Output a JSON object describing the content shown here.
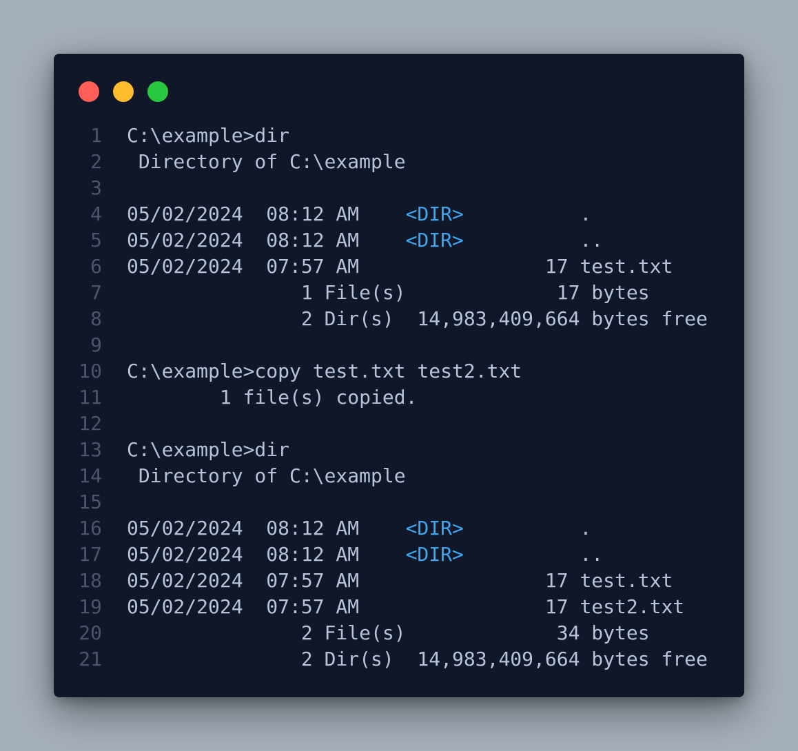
{
  "window": {
    "controls": [
      "close",
      "minimize",
      "maximize"
    ],
    "colors": {
      "background": "#0f1729",
      "text": "#b7c3d8",
      "line_number": "#4a556b",
      "dir_tag": "#3fa7f0",
      "close": "#ff5f57",
      "minimize": "#febc2e",
      "maximize": "#28c840"
    }
  },
  "lines": [
    {
      "n": "1",
      "pre": "C:\\example>dir",
      "tag": "",
      "post": ""
    },
    {
      "n": "2",
      "pre": " Directory of C:\\example",
      "tag": "",
      "post": ""
    },
    {
      "n": "3",
      "pre": "",
      "tag": "",
      "post": ""
    },
    {
      "n": "4",
      "pre": "05/02/2024  08:12 AM    ",
      "tag": "<DIR>",
      "post": "          ."
    },
    {
      "n": "5",
      "pre": "05/02/2024  08:12 AM    ",
      "tag": "<DIR>",
      "post": "          .."
    },
    {
      "n": "6",
      "pre": "05/02/2024  07:57 AM                17 test.txt",
      "tag": "",
      "post": ""
    },
    {
      "n": "7",
      "pre": "               1 File(s)             17 bytes",
      "tag": "",
      "post": ""
    },
    {
      "n": "8",
      "pre": "               2 Dir(s)  14,983,409,664 bytes free",
      "tag": "",
      "post": ""
    },
    {
      "n": "9",
      "pre": "",
      "tag": "",
      "post": ""
    },
    {
      "n": "10",
      "pre": "C:\\example>copy test.txt test2.txt",
      "tag": "",
      "post": ""
    },
    {
      "n": "11",
      "pre": "        1 file(s) copied.",
      "tag": "",
      "post": ""
    },
    {
      "n": "12",
      "pre": "",
      "tag": "",
      "post": ""
    },
    {
      "n": "13",
      "pre": "C:\\example>dir",
      "tag": "",
      "post": ""
    },
    {
      "n": "14",
      "pre": " Directory of C:\\example",
      "tag": "",
      "post": ""
    },
    {
      "n": "15",
      "pre": "",
      "tag": "",
      "post": ""
    },
    {
      "n": "16",
      "pre": "05/02/2024  08:12 AM    ",
      "tag": "<DIR>",
      "post": "          ."
    },
    {
      "n": "17",
      "pre": "05/02/2024  08:12 AM    ",
      "tag": "<DIR>",
      "post": "          .."
    },
    {
      "n": "18",
      "pre": "05/02/2024  07:57 AM                17 test.txt",
      "tag": "",
      "post": ""
    },
    {
      "n": "19",
      "pre": "05/02/2024  07:57 AM                17 test2.txt",
      "tag": "",
      "post": ""
    },
    {
      "n": "20",
      "pre": "               2 File(s)             34 bytes",
      "tag": "",
      "post": ""
    },
    {
      "n": "21",
      "pre": "               2 Dir(s)  14,983,409,664 bytes free",
      "tag": "",
      "post": ""
    }
  ]
}
